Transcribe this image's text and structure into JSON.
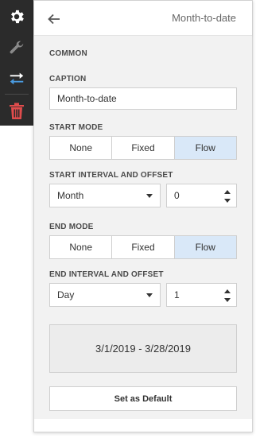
{
  "toolbar": {
    "items": [
      {
        "icon": "gear-icon",
        "color": "#ffffff"
      },
      {
        "icon": "wrench-icon",
        "color": "#8a8a8a"
      },
      {
        "icon": "swap-arrows-icon",
        "color": "#ffffff"
      },
      {
        "icon": "trash-icon",
        "color": "#e04c4c"
      }
    ]
  },
  "header": {
    "title": "Month-to-date",
    "back_icon": "back-arrow-icon"
  },
  "sections": {
    "common": "COMMON",
    "caption_label": "CAPTION",
    "caption_value": "Month-to-date",
    "start_mode_label": "START MODE",
    "start_mode_options": [
      "None",
      "Fixed",
      "Flow"
    ],
    "start_mode_selected": "Flow",
    "start_interval_label": "START INTERVAL AND OFFSET",
    "start_interval_value": "Month",
    "start_offset_value": "0",
    "end_mode_label": "END MODE",
    "end_mode_options": [
      "None",
      "Fixed",
      "Flow"
    ],
    "end_mode_selected": "Flow",
    "end_interval_label": "END INTERVAL AND OFFSET",
    "end_interval_value": "Day",
    "end_offset_value": "1"
  },
  "range_preview": "3/1/2019 - 3/28/2019",
  "default_button": "Set as Default",
  "colors": {
    "toolbar_bg": "#2b2b2b",
    "selected_segment": "#d9e8f8",
    "panel_bg": "#f2f2f2"
  }
}
